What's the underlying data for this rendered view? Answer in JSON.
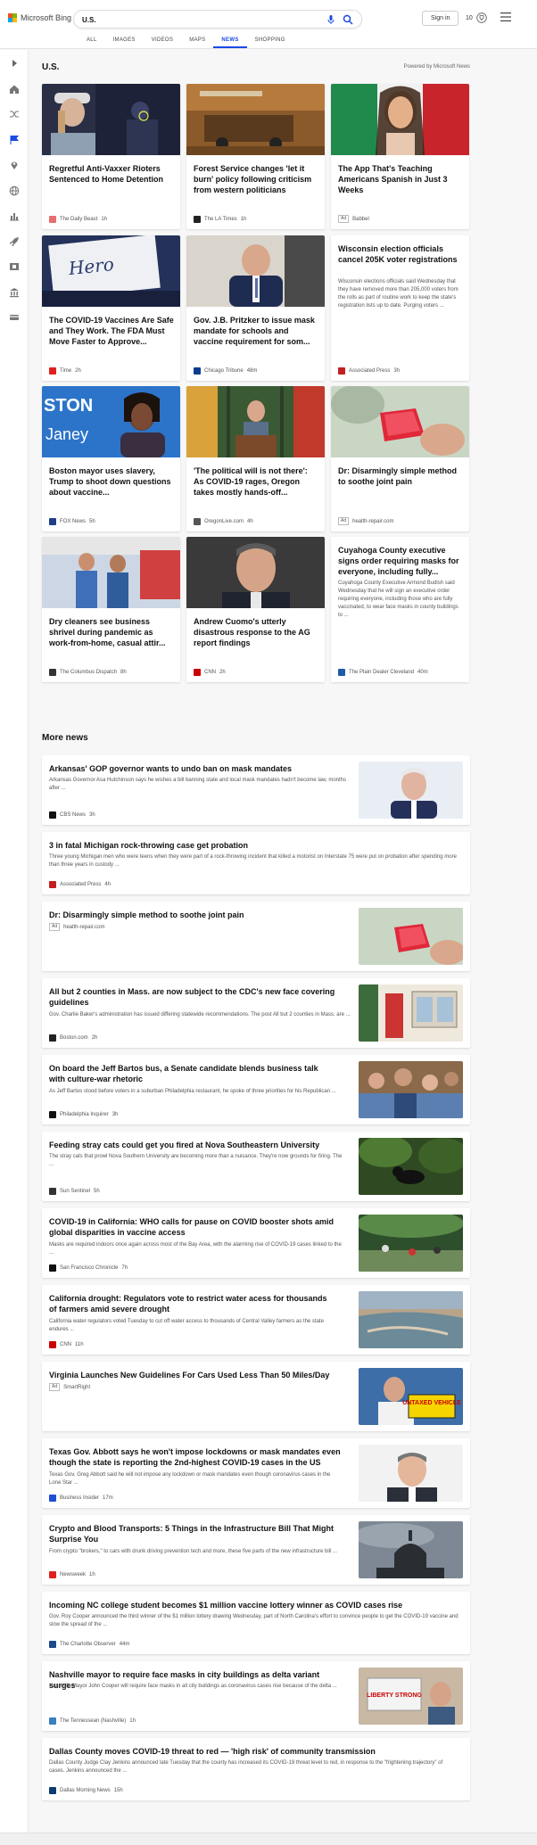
{
  "header": {
    "logo_text": "Microsoft Bing",
    "search_value": "U.S.",
    "signin_label": "Sign in",
    "rewards_count": "10",
    "tabs": [
      {
        "label": "ALL"
      },
      {
        "label": "IMAGES"
      },
      {
        "label": "VIDEOS"
      },
      {
        "label": "MAPS"
      },
      {
        "label": "NEWS"
      },
      {
        "label": "SHOPPING"
      }
    ]
  },
  "sidebar": {
    "icons": [
      "expand-icon",
      "home-icon",
      "shuffle-icon",
      "flag-icon",
      "pin-icon",
      "globe-icon",
      "chart-icon",
      "rocket-icon",
      "film-icon",
      "building-icon",
      "card-icon"
    ]
  },
  "section": {
    "title": "U.S.",
    "powered_by": "Powered by Microsoft News"
  },
  "cards": [
    {
      "title": "Regretful Anti-Vaxxer Rioters Sentenced to Home Detention",
      "source": "The Daily Beast",
      "time": "1h",
      "image": "woman in cap and police"
    },
    {
      "title": "Forest Service changes 'let it burn' policy following criticism from western politicians",
      "source": "The LA Times",
      "time": "1h",
      "image": "fire truck in smoke"
    },
    {
      "title": "The App That's Teaching Americans Spanish in Just 3 Weeks",
      "source": "Babbel",
      "ad": "Ad",
      "image": "woman with Mexican flag"
    },
    {
      "title": "The COVID-19 Vaccines Are Safe and They Work. The FDA Must Move Faster to Approve...",
      "source": "Time",
      "time": "2h",
      "image": "vaccine hero sign"
    },
    {
      "title": "Gov. J.B. Pritzker to issue mask mandate for schools and vaccine requirement for som...",
      "source": "Chicago Tribune",
      "time": "48m",
      "image": "man in suit at desk"
    },
    {
      "title": "Wisconsin election officials cancel 205K voter registrations",
      "snippet": "Wisconsin elections officials said Wednesday that they have removed more than 205,000 voters from the rolls as part of routine work to keep the state's registration lists up to date. Purging voters ...",
      "source": "Associated Press",
      "time": "3h"
    },
    {
      "title": "Boston mayor uses slavery, Trump to shoot down questions about vaccine...",
      "source": "FOX News",
      "time": "5h",
      "image": "woman in front of banner"
    },
    {
      "title": "'The political will is not there': As COVID-19 rages, Oregon takes mostly hands-off...",
      "source": "OregonLive.com",
      "time": "4h",
      "image": "woman at podium"
    },
    {
      "title": "Dr: Disarmingly simple method to soothe joint pain",
      "source": "health-repair.com",
      "ad": "Ad",
      "image": "red gummy"
    },
    {
      "title": "Dry cleaners see business shrivel during pandemic as work-from-home, casual attir...",
      "source": "The Columbus Dispatch",
      "time": "8h",
      "image": "two people in dry cleaner"
    },
    {
      "title": "Andrew Cuomo's utterly disastrous response to the AG report findings",
      "source": "CNN",
      "time": "2h",
      "image": "Cuomo portrait"
    },
    {
      "title": "Cuyahoga County executive signs order requiring masks for everyone, including fully...",
      "snippet": "Cuyahoga County Executive Armond Budish said Wednesday that he will sign an executive order requiring everyone, including those who are fully vaccinated, to wear face masks in county buildings to ...",
      "source": "The Plain Dealer Cleveland",
      "time": "40m"
    }
  ],
  "more_news": {
    "title": "More news",
    "items": [
      {
        "title": "Arkansas' GOP governor wants to undo ban on mask mandates",
        "snippet": "Arkansas Governor Asa Hutchinson says he wishes a bill banning state and local mask mandates hadn't become law, months after ...",
        "source": "CBS News",
        "time": "3h",
        "image": "governor portrait"
      },
      {
        "title": "3 in fatal Michigan rock-throwing case get probation",
        "snippet": "Three young Michigan men who were teens when they were part of a rock-throwing incident that killed a motorist on Interstate 75 were put on probation after spending more than three years in custody ...",
        "source": "Associated Press",
        "time": "4h"
      },
      {
        "title": "Dr: Disarmingly simple method to soothe joint pain",
        "source": "health-repair.com",
        "ad": "Ad",
        "image": "red gummy"
      },
      {
        "title": "All but 2 counties in Mass. are now subject to the CDC's new face covering guidelines",
        "snippet": "Gov. Charlie Baker's administration has issued differing statewide recommendations. The post All but 2 counties in Mass. are ...",
        "source": "Boston.com",
        "time": "2h",
        "image": "storefront"
      },
      {
        "title": "On board the Jeff Bartos bus, a Senate candidate blends business talk with culture-war rhetoric",
        "snippet": "As Jeff Bartos stood before voters in a suburban Philadelphia restaurant, he spoke of three priorities for his Republican ...",
        "source": "Philadelphia Inquirer",
        "time": "3h",
        "image": "crowd in restaurant"
      },
      {
        "title": "Feeding stray cats could get you fired at Nova Southeastern University",
        "snippet": "The stray cats that prowl Nova Southern University are becoming more than a nuisance. They're now grounds for firing. The ...",
        "source": "Sun Sentinel",
        "time": "5h",
        "image": "cat in grass"
      },
      {
        "title": "COVID-19 in California: WHO calls for pause on COVID booster shots amid global disparities in vaccine access",
        "snippet": "Masks are required indoors once again across most of the Bay Area, with the alarming rise of COVID-19 cases linked to the ...",
        "source": "San Francisco Chronicle",
        "time": "7h",
        "image": "people in park"
      },
      {
        "title": "California drought: Regulators vote to restrict water acess for thousands of farmers amid severe drought",
        "snippet": "California water regulators voted Tuesday to cut off water access to thousands of Central Valley farmers as the state endures ...",
        "source": "CNN",
        "time": "11h",
        "image": "dry lake"
      },
      {
        "title": "Virginia Launches New Guidelines For Cars Used Less Than 50 Miles/Day",
        "source": "SmartRight",
        "ad": "Ad",
        "image": "man with sign",
        "sign_text": "UNTAXED VEHICLE"
      },
      {
        "title": "Texas Gov. Abbott says he won't impose lockdowns or mask mandates even though the state is reporting the 2nd-highest COVID-19 cases in the US",
        "snippet": "Texas Gov. Greg Abbott said he will not impose any lockdown or mask mandates even though coronavirus cases in the Lone Star ...",
        "source": "Business Insider",
        "time": "17m",
        "image": "Abbott portrait"
      },
      {
        "title": "Crypto and Blood Transports: 5 Things in the Infrastructure Bill That Might Surprise You",
        "snippet": "From crypto \"brokers,\" to cars with drunk driving prevention tech and more, these five parts of the new infrastructure bill ...",
        "source": "Newsweek",
        "time": "1h",
        "image": "capitol dome"
      },
      {
        "title": "Incoming NC college student becomes $1 million vaccine lottery winner as COVID cases rise",
        "snippet": "Gov. Roy Cooper announced the third winner of the $1 million lottery drawing Wednesday, part of North Carolina's effort to convince people to get the COVID-19 vaccine and slow the spread of the ...",
        "source": "The Charlotte Observer",
        "time": "44m"
      },
      {
        "title": "Nashville mayor to require face masks in city buildings as delta variant surges",
        "snippet": "Nashville Mayor John Cooper will require face masks in all city buildings as coronavirus cases rise because of the delta ...",
        "source": "The Tennessean (Nashville)",
        "time": "1h",
        "image": "protest signs",
        "sign_text": "LIBERTY STRONG"
      },
      {
        "title": "Dallas County moves COVID-19 threat to red — 'high risk' of community transmission",
        "snippet": "Dallas County Judge Clay Jenkins announced late Tuesday that the county has increased its COVID-19 threat level to red, in response to the \"frightening trajectory\" of cases. Jenkins announced the ...",
        "source": "Dallas Morning News",
        "time": "15h"
      }
    ]
  },
  "colors": {
    "accent": "#174ae4",
    "logo": [
      "#f25022",
      "#7fba00",
      "#00a4ef",
      "#ffb900"
    ]
  }
}
